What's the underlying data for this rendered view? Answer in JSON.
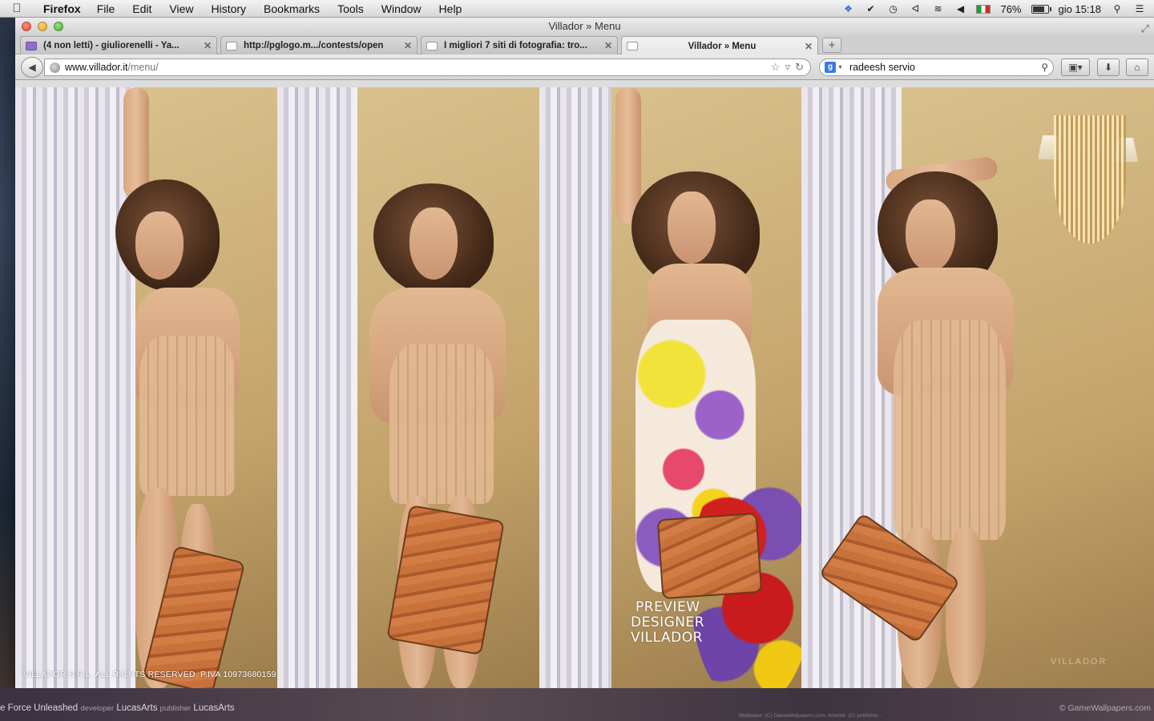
{
  "menubar": {
    "app_name": "Firefox",
    "items": [
      "File",
      "Edit",
      "View",
      "History",
      "Bookmarks",
      "Tools",
      "Window",
      "Help"
    ],
    "battery_percent": "76%",
    "clock": "gio 15:18"
  },
  "window": {
    "title": "Villador » Menu"
  },
  "tabs": [
    {
      "label": "(4 non letti) - giuliorenelli - Ya...",
      "active": false
    },
    {
      "label": "http://pglogo.m.../contests/open",
      "active": false
    },
    {
      "label": "I migliori 7 siti di fotografia: tro...",
      "active": false
    },
    {
      "label": "Villador » Menu",
      "active": true
    }
  ],
  "navbar": {
    "url_host": "www.villador.it",
    "url_path": "/menu/",
    "search_value": "radeesh servio"
  },
  "page": {
    "preview_lines": [
      "PREVIEW",
      "DESIGNER",
      "VILLADOR"
    ],
    "copyright": "VILLADOR S.R.L. ALL RIGHTS RESERVED. P.IVA 10973680159",
    "watermark": "VILLADOR"
  },
  "desktop": {
    "game_title": "e Force Unleashed",
    "developer_label": "developer",
    "developer": "LucasArts",
    "publisher_label": "publisher",
    "publisher": "LucasArts",
    "site": "© GameWallpapers.com",
    "credit": "Wallpaper: (C) GameWallpapers.com. Artwork: (C) publisher..."
  },
  "colors": {
    "accent_google": "#3b78e7",
    "mail_favicon": "#8d6fc8"
  }
}
